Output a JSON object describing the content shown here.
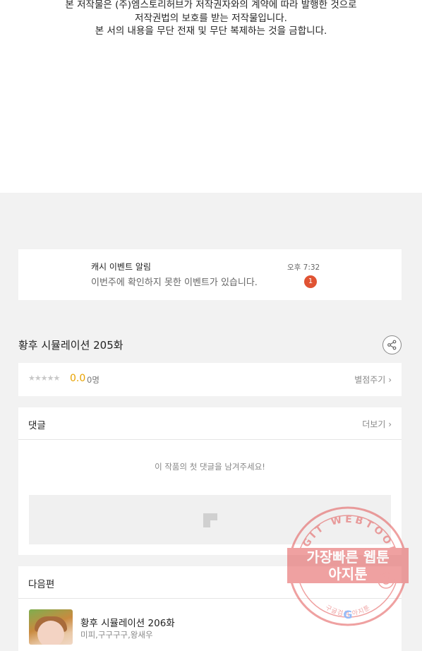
{
  "copyright": {
    "line1": "본 저작물은 (주)엠스토리허브가 저작권자와의 계약에 따라 발행한 것으로",
    "line2": "저작권법의 보호를 받는 저작물입니다.",
    "line3": "본 서의 내용을 무단 전재 및 무단 복제하는 것을 금합니다."
  },
  "notification": {
    "title": "캐시 이벤트 알림",
    "message": "이번주에 확인하지 못한 이벤트가 있습니다.",
    "time": "오후 7:32",
    "badge": "1"
  },
  "episode": {
    "title": "황후 시뮬레이션 205화",
    "share_icon": "share-icon"
  },
  "rating": {
    "stars": "★★★★★",
    "score": "0.0",
    "raters": "0명",
    "rate_link": "별점주기"
  },
  "comments": {
    "title": "댓글",
    "more": "더보기",
    "empty": "이 작품의 첫 댓글을 남겨주세요!"
  },
  "next": {
    "title": "다음편",
    "episode_title": "황후 시뮬레이션 206화",
    "authors": "미피,구구구구,왕새우"
  },
  "watermark": {
    "ring_text": "AGIT WEBTOON",
    "line1": "가장빠른 웹툰",
    "line2": "아지툰",
    "bottom_text": "구글검색 아지툰",
    "accent": "#e25555"
  },
  "colors": {
    "accent": "#e8a200",
    "badge": "#e05333"
  }
}
